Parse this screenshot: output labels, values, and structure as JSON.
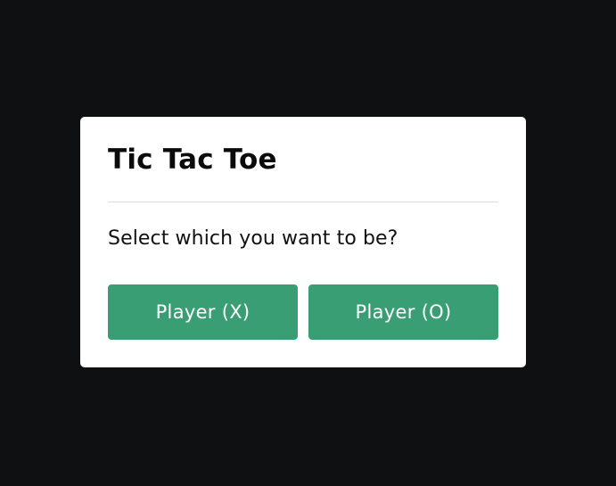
{
  "dialog": {
    "title": "Tic Tac Toe",
    "prompt": "Select which you want to be?",
    "buttons": {
      "player_x_label": "Player (X)",
      "player_o_label": "Player (O)"
    }
  },
  "colors": {
    "background": "#0f1012",
    "dialog_background": "#ffffff",
    "button": "#3a9e74",
    "button_text": "#ffffff",
    "divider": "#dcdcdc"
  }
}
